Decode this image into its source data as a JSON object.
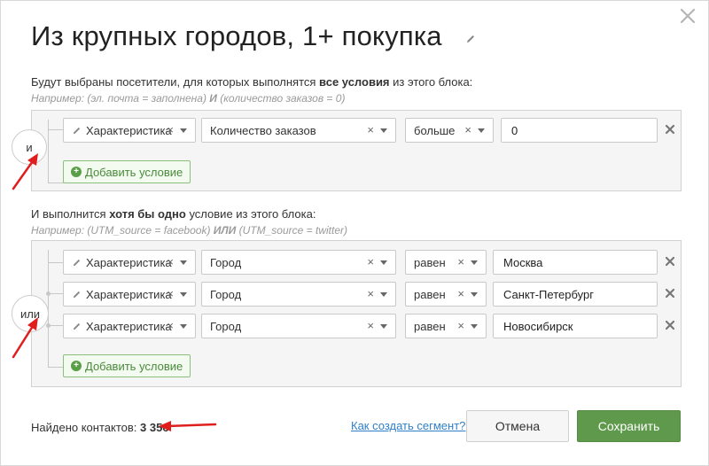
{
  "title": "Из крупных городов, 1+ покупка",
  "block1": {
    "desc_prefix": "Будут выбраны посетители, для которых выполнятся ",
    "desc_bold": "все условия",
    "desc_suffix": " из этого блока:",
    "hint_prefix": "Например: (эл. почта = заполнена) ",
    "hint_bold": "И",
    "hint_suffix": " (количество заказов = 0)",
    "connector": "и",
    "conditions": [
      {
        "type": "Характеристика",
        "field": "Количество заказов",
        "op": "больше",
        "value": "0"
      }
    ],
    "add_label": "Добавить условие"
  },
  "block2": {
    "desc_prefix": "И выполнится ",
    "desc_bold": "хотя бы одно",
    "desc_suffix": " условие из этого блока:",
    "hint_prefix": "Например: (UTM_source = facebook) ",
    "hint_bold": "ИЛИ",
    "hint_suffix": " (UTM_source = twitter)",
    "connector": "или",
    "conditions": [
      {
        "type": "Характеристика",
        "field": "Город",
        "op": "равен",
        "value": "Москва"
      },
      {
        "type": "Характеристика",
        "field": "Город",
        "op": "равен",
        "value": "Санкт-Петербург"
      },
      {
        "type": "Характеристика",
        "field": "Город",
        "op": "равен",
        "value": "Новосибирск"
      }
    ],
    "add_label": "Добавить условие"
  },
  "footer": {
    "found_label": "Найдено контактов: ",
    "found_count": "3 356",
    "help_link": "Как создать сегмент?",
    "cancel": "Отмена",
    "save": "Сохранить"
  },
  "colors": {
    "accent_green": "#5f9a4c",
    "link_blue": "#2f7fc9",
    "annotation_red": "#e01e1e"
  },
  "icons": {
    "close": "close-icon",
    "edit": "pencil-icon",
    "remove": "remove-x-icon",
    "add": "plus-circle-icon"
  }
}
